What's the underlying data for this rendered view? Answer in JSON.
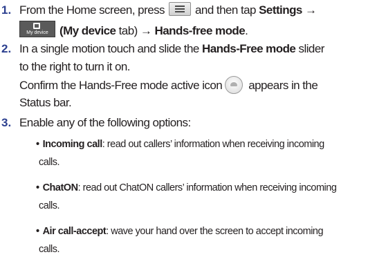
{
  "step1": {
    "number": "1.",
    "text_a": "From the Home screen, press",
    "text_b": "and then tap",
    "settings": "Settings →",
    "device_icon_label": "My device",
    "tab_text": "(My device",
    "tab_text_b": "tab)",
    "arrow": "→",
    "hands_free": "Hands-free mode",
    "period": "."
  },
  "step2": {
    "number": "2.",
    "line1_a": "In a single motion touch and slide the",
    "line1_b": "Hands-Free mode",
    "line1_c": "slider",
    "line2": "to the right to turn it on.",
    "line3_a": "Confirm the Hands-Free mode active icon",
    "line3_b": "appears in the",
    "line4": "Status bar."
  },
  "step3": {
    "number": "3.",
    "intro": "Enable any of the following options:",
    "bullet": "•",
    "options": [
      {
        "name": "Incoming call",
        "desc": ": read out callers’ information when receiving incoming",
        "cont": "calls."
      },
      {
        "name": "ChatON",
        "desc": ": read out ChatON callers’ information when receiving incoming",
        "cont": "calls."
      },
      {
        "name": "Air call-accept",
        "desc": ": wave your hand over the screen to accept incoming",
        "cont": "calls."
      }
    ]
  },
  "icons": {
    "menu": "menu-key-icon",
    "device": "my-device-tab-icon",
    "hands_free": "hands-free-mode-active-icon"
  }
}
